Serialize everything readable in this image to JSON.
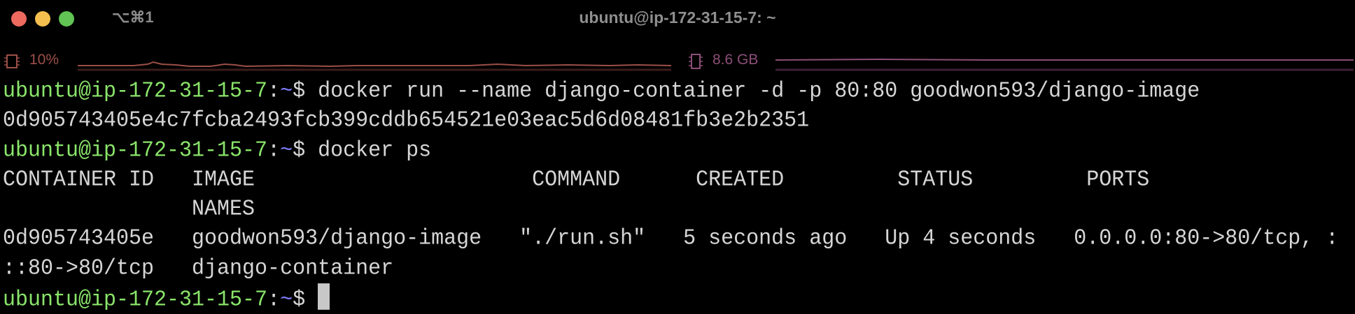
{
  "window": {
    "title": "ubuntu@ip-172-31-15-7: ~",
    "shortcut": "⌥⌘1"
  },
  "status_bar": {
    "cpu": {
      "icon": "cpu-chip-icon",
      "label": "10%",
      "color": "#9c4f48"
    },
    "memory": {
      "icon": "memory-icon",
      "label": "8.6 GB",
      "color": "#8c4f78"
    }
  },
  "colors": {
    "prompt_user": "#8ae56a",
    "prompt_path": "#7f7fff",
    "text": "#d6d6d6"
  },
  "terminal": {
    "prompt": {
      "user_host": "ubuntu@ip-172-31-15-7",
      "sep": ":",
      "path": "~",
      "symbol": "$ "
    },
    "lines": [
      {
        "type": "command",
        "text": "docker run --name django-container -d -p 80:80 goodwon593/django-image"
      },
      {
        "type": "output",
        "text": "0d905743405e4c7fcba2493fcb399cddb654521e03eac5d6d08481fb3e2b2351"
      },
      {
        "type": "command",
        "text": "docker ps"
      },
      {
        "type": "output",
        "text": "CONTAINER ID   IMAGE                      COMMAND      CREATED         STATUS         PORTS"
      },
      {
        "type": "output",
        "text": "               NAMES"
      },
      {
        "type": "output",
        "text": "0d905743405e   goodwon593/django-image   \"./run.sh\"   5 seconds ago   Up 4 seconds   0.0.0.0:80->80/tcp, :"
      },
      {
        "type": "output",
        "text": "::80->80/tcp   django-container"
      },
      {
        "type": "command",
        "text": ""
      }
    ]
  }
}
